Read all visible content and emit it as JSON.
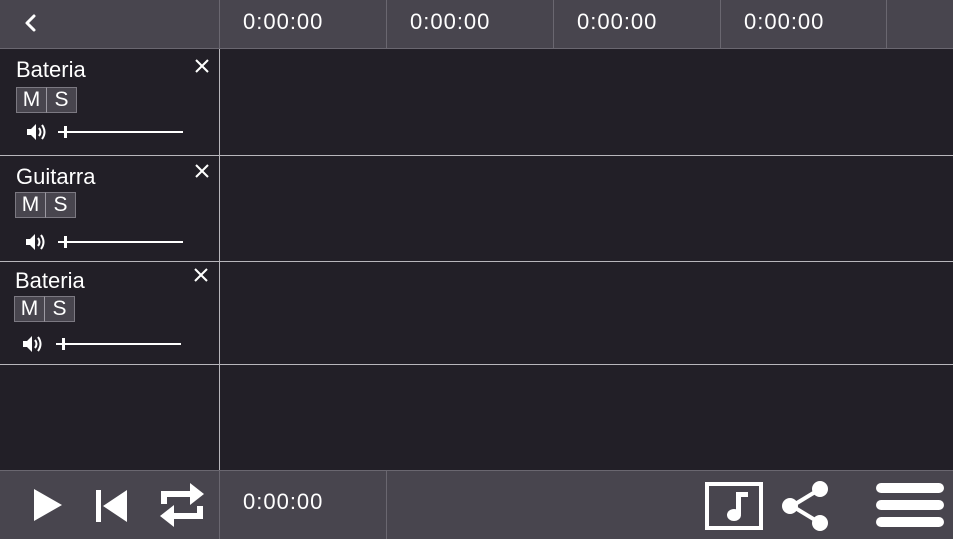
{
  "header": {
    "back_icon": "chevron-left-icon",
    "timeline_marks": [
      "0:00:00",
      "0:00:00",
      "0:00:00",
      "0:00:00"
    ]
  },
  "tracks": [
    {
      "name": "Bateria",
      "mute_label": "M",
      "solo_label": "S",
      "volume": 0.05
    },
    {
      "name": "Guitarra",
      "mute_label": "M",
      "solo_label": "S",
      "volume": 0.05
    },
    {
      "name": "Bateria",
      "mute_label": "M",
      "solo_label": "S",
      "volume": 0.05
    }
  ],
  "transport": {
    "play_icon": "play-icon",
    "rewind_icon": "skip-to-start-icon",
    "loop_icon": "loop-icon",
    "current_time": "0:00:00"
  },
  "toolbar": {
    "music_icon": "music-note-icon",
    "share_icon": "share-icon",
    "menu_icon": "menu-icon"
  },
  "colors": {
    "background": "#221f27",
    "bar": "#48454e",
    "divider": "#b8b6bc",
    "text": "#ffffff"
  }
}
